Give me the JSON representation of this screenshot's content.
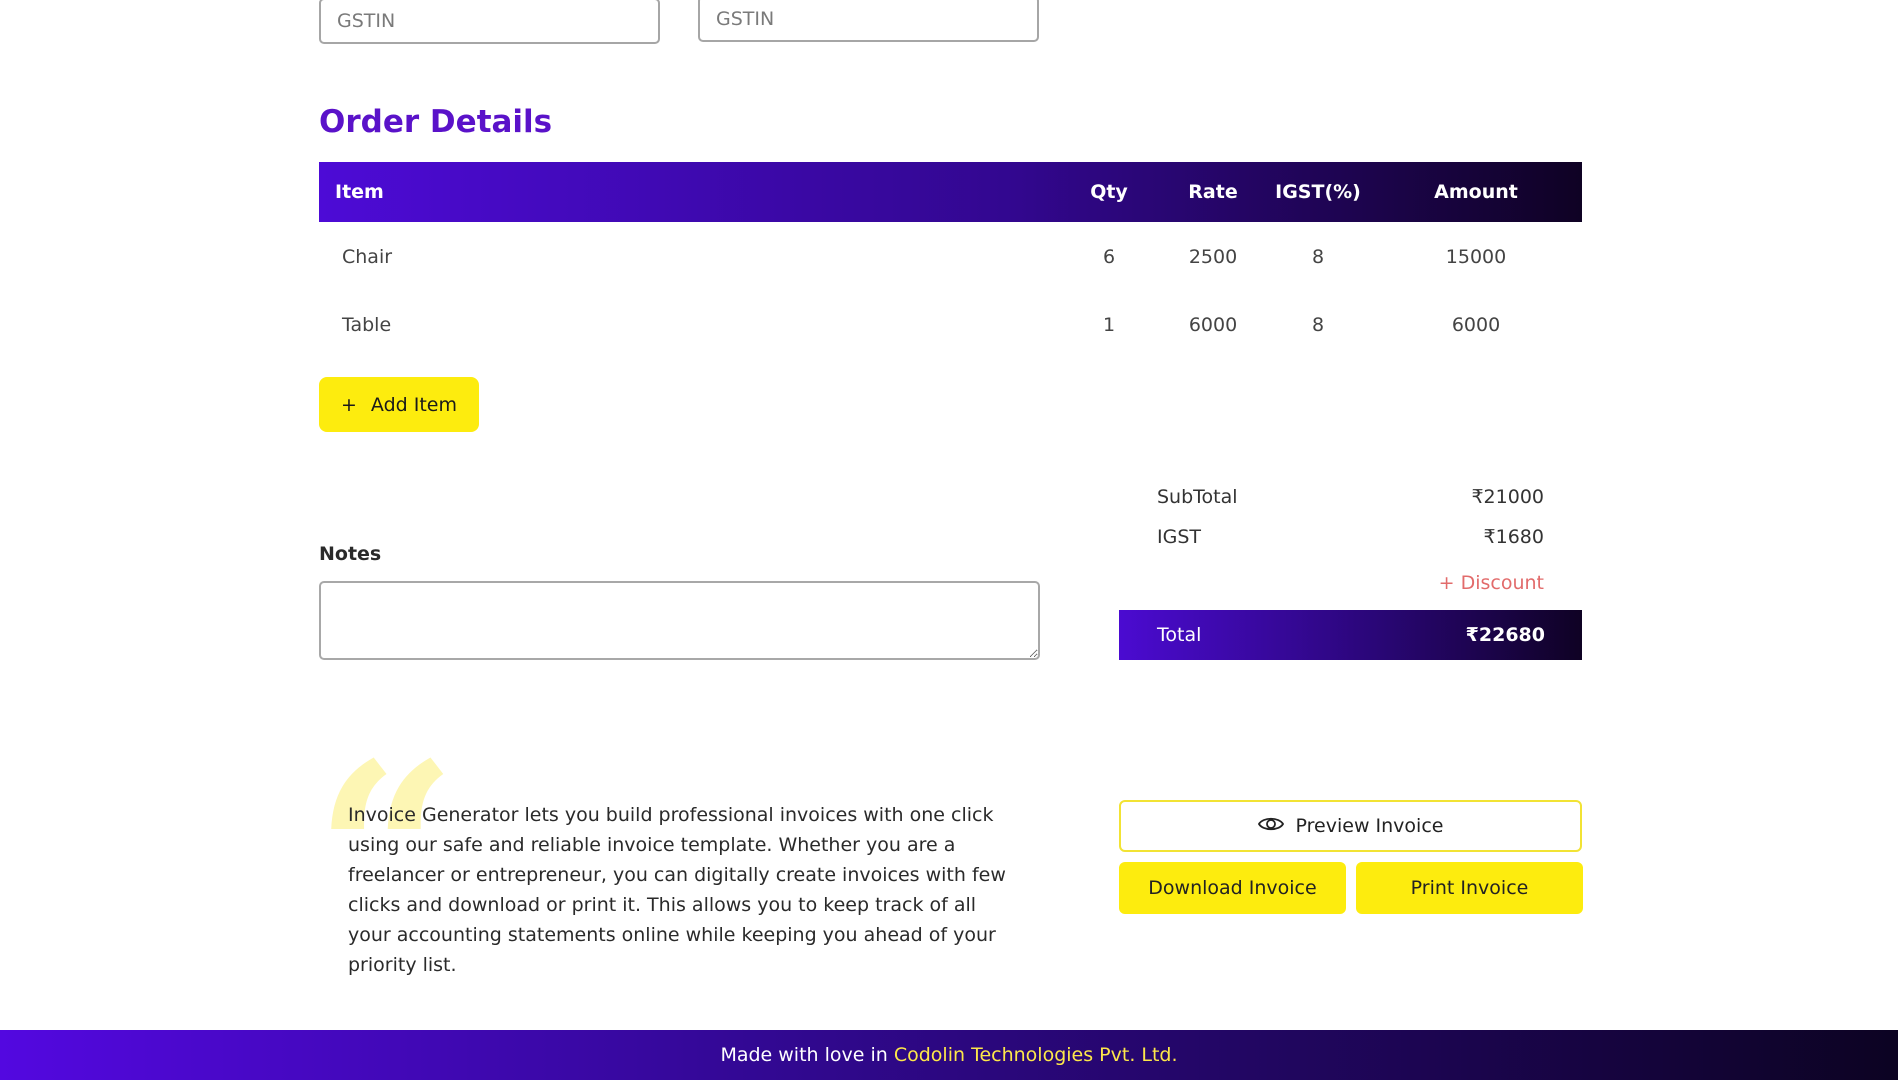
{
  "gstin": {
    "placeholder_left": "GSTIN",
    "placeholder_right": "GSTIN"
  },
  "order": {
    "title": "Order Details",
    "columns": [
      "Item",
      "Qty",
      "Rate",
      "IGST(%)",
      "Amount"
    ],
    "rows": [
      {
        "item": "Chair",
        "qty": "6",
        "rate": "2500",
        "igst": "8",
        "amount": "15000"
      },
      {
        "item": "Table",
        "qty": "1",
        "rate": "6000",
        "igst": "8",
        "amount": "6000"
      }
    ],
    "add_item_icon": "+",
    "add_item_label": "Add Item"
  },
  "notes": {
    "label": "Notes",
    "value": ""
  },
  "summary": {
    "subtotal_label": "SubTotal",
    "subtotal_value": "₹21000",
    "igst_label": "IGST",
    "igst_value": "₹1680",
    "discount_label": "+ Discount",
    "total_label": "Total",
    "total_value": "₹22680"
  },
  "about": {
    "quote_glyph": "“",
    "text": "Invoice Generator lets you build professional invoices with one click using our safe and reliable invoice template. Whether you are a freelancer or entrepreneur, you can digitally create invoices with few clicks and download or print it. This allows you to keep track of all your accounting statements online while keeping you ahead of your priority list."
  },
  "actions": {
    "preview_icon": "eye-icon",
    "preview_label": "Preview Invoice",
    "download_label": "Download Invoice",
    "print_label": "Print Invoice"
  },
  "footer": {
    "prefix": "Made with love in ",
    "brand": "Codolin Technologies Pvt. Ltd."
  },
  "colors": {
    "accent_purple": "#5a12c9",
    "accent_yellow": "#fdec0e",
    "discount_red": "#e26b6b"
  }
}
